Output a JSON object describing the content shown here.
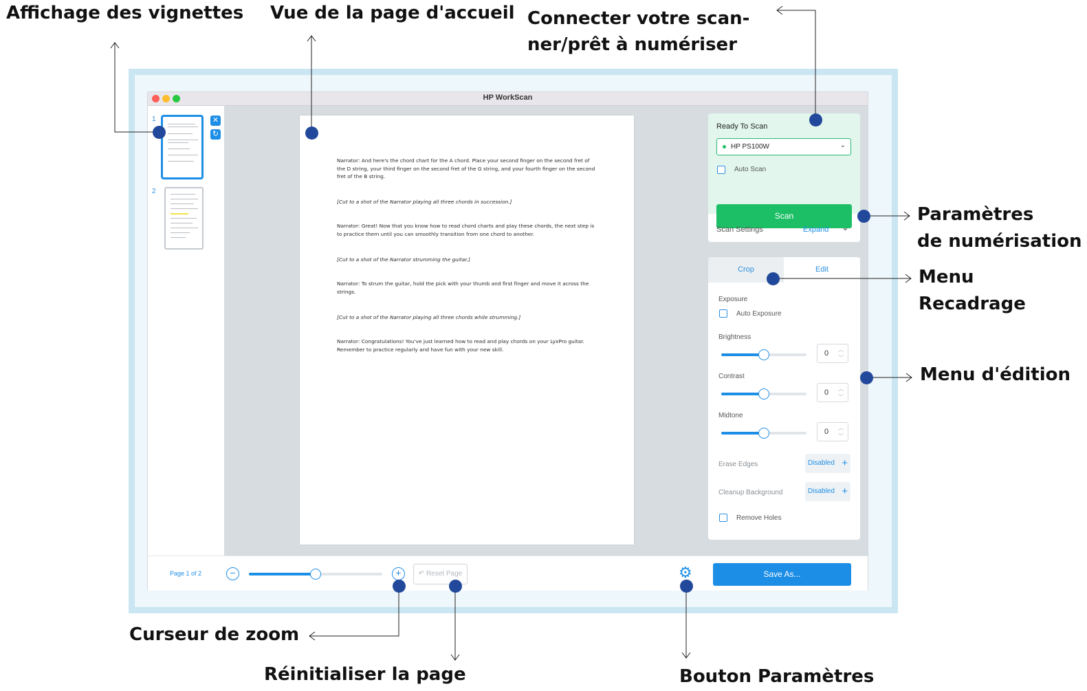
{
  "callouts": {
    "thumbnails": "Affichage des vignettes",
    "home_view": "Vue de la page d'accueil",
    "connect_line1": "Connecter votre scan-",
    "connect_line2": "ner/prêt à numériser",
    "scan_params_line1": "Paramètres",
    "scan_params_line2": "de numérisation",
    "crop_menu_line1": "Menu",
    "crop_menu_line2": "Recadrage",
    "edit_menu": "Menu d'édition",
    "zoom_slider": "Curseur de zoom",
    "reset_page": "Réinitialiser la page",
    "settings_button": "Bouton Paramètres"
  },
  "window": {
    "title": "HP WorkScan",
    "traffic_lights": [
      "#ff5f57",
      "#febc2e",
      "#28c840"
    ]
  },
  "thumbnails": {
    "items": [
      {
        "number": "1",
        "selected": true
      },
      {
        "number": "2",
        "selected": false
      }
    ],
    "delete_icon": "close-icon",
    "rotate_icon": "rotate-icon"
  },
  "document": {
    "paragraphs": [
      {
        "text": "Narrator: And here's the chord chart for the A chord. Place your second finger on the second fret of the D string, your third finger on the second fret of the G string, and your fourth finger on the second fret of the B string.",
        "italic": false
      },
      {
        "text": "[Cut to a shot of the Narrator playing all three chords in succession.]",
        "italic": true
      },
      {
        "text": "Narrator: Great! Now that you know how to read chord charts and play these chords, the next step is to practice them until you can smoothly transition from one chord to another.",
        "italic": false
      },
      {
        "text": "[Cut to a shot of the Narrator strumming the guitar.]",
        "italic": true
      },
      {
        "text": "Narrator: To strum the guitar, hold the pick with your thumb and first finger and move it across the strings.",
        "italic": false
      },
      {
        "text": "[Cut to a shot of the Narrator playing all three chords while strumming.]",
        "italic": true
      },
      {
        "text": "Narrator: Congratulations! You've just learned how to read and play chords on your LyxPro guitar. Remember to practice regularly and have fun with your new skill.",
        "italic": false
      }
    ]
  },
  "scanner": {
    "status": "Ready To Scan",
    "device": "HP PS100W",
    "device_status_color": "#1dbf66",
    "auto_scan_label": "Auto Scan",
    "auto_scan_checked": false,
    "scan_button": "Scan",
    "scan_settings_label": "Scan Settings",
    "expand_label": "Expand"
  },
  "edit_panel": {
    "tabs": [
      {
        "label": "Crop",
        "active": false
      },
      {
        "label": "Edit",
        "active": true
      }
    ],
    "exposure_label": "Exposure",
    "auto_exposure_label": "Auto Exposure",
    "auto_exposure_checked": false,
    "sliders": [
      {
        "label": "Brightness",
        "value": "0",
        "level": 0.5
      },
      {
        "label": "Contrast",
        "value": "0",
        "level": 0.5
      },
      {
        "label": "Midtone",
        "value": "0",
        "level": 0.5
      }
    ],
    "erase_edges_label": "Erase Edges",
    "erase_edges_value": "Disabled",
    "cleanup_background_label": "Cleanup Background",
    "cleanup_background_value": "Disabled",
    "remove_holes_label": "Remove Holes",
    "remove_holes_checked": false
  },
  "bottom_bar": {
    "page_indicator": "Page 1 of 2",
    "zoom_level": 0.5,
    "zoom_out_icon": "minus-icon",
    "zoom_in_icon": "plus-icon",
    "reset_page_label": "Reset Page",
    "settings_icon": "gear-icon",
    "save_as_label": "Save As..."
  },
  "colors": {
    "accent": "#1d8ee6",
    "scan_green": "#1dbf66",
    "ready_bg": "#e2f6ee",
    "marker": "#21489a",
    "frame": "#c9e6f2"
  }
}
